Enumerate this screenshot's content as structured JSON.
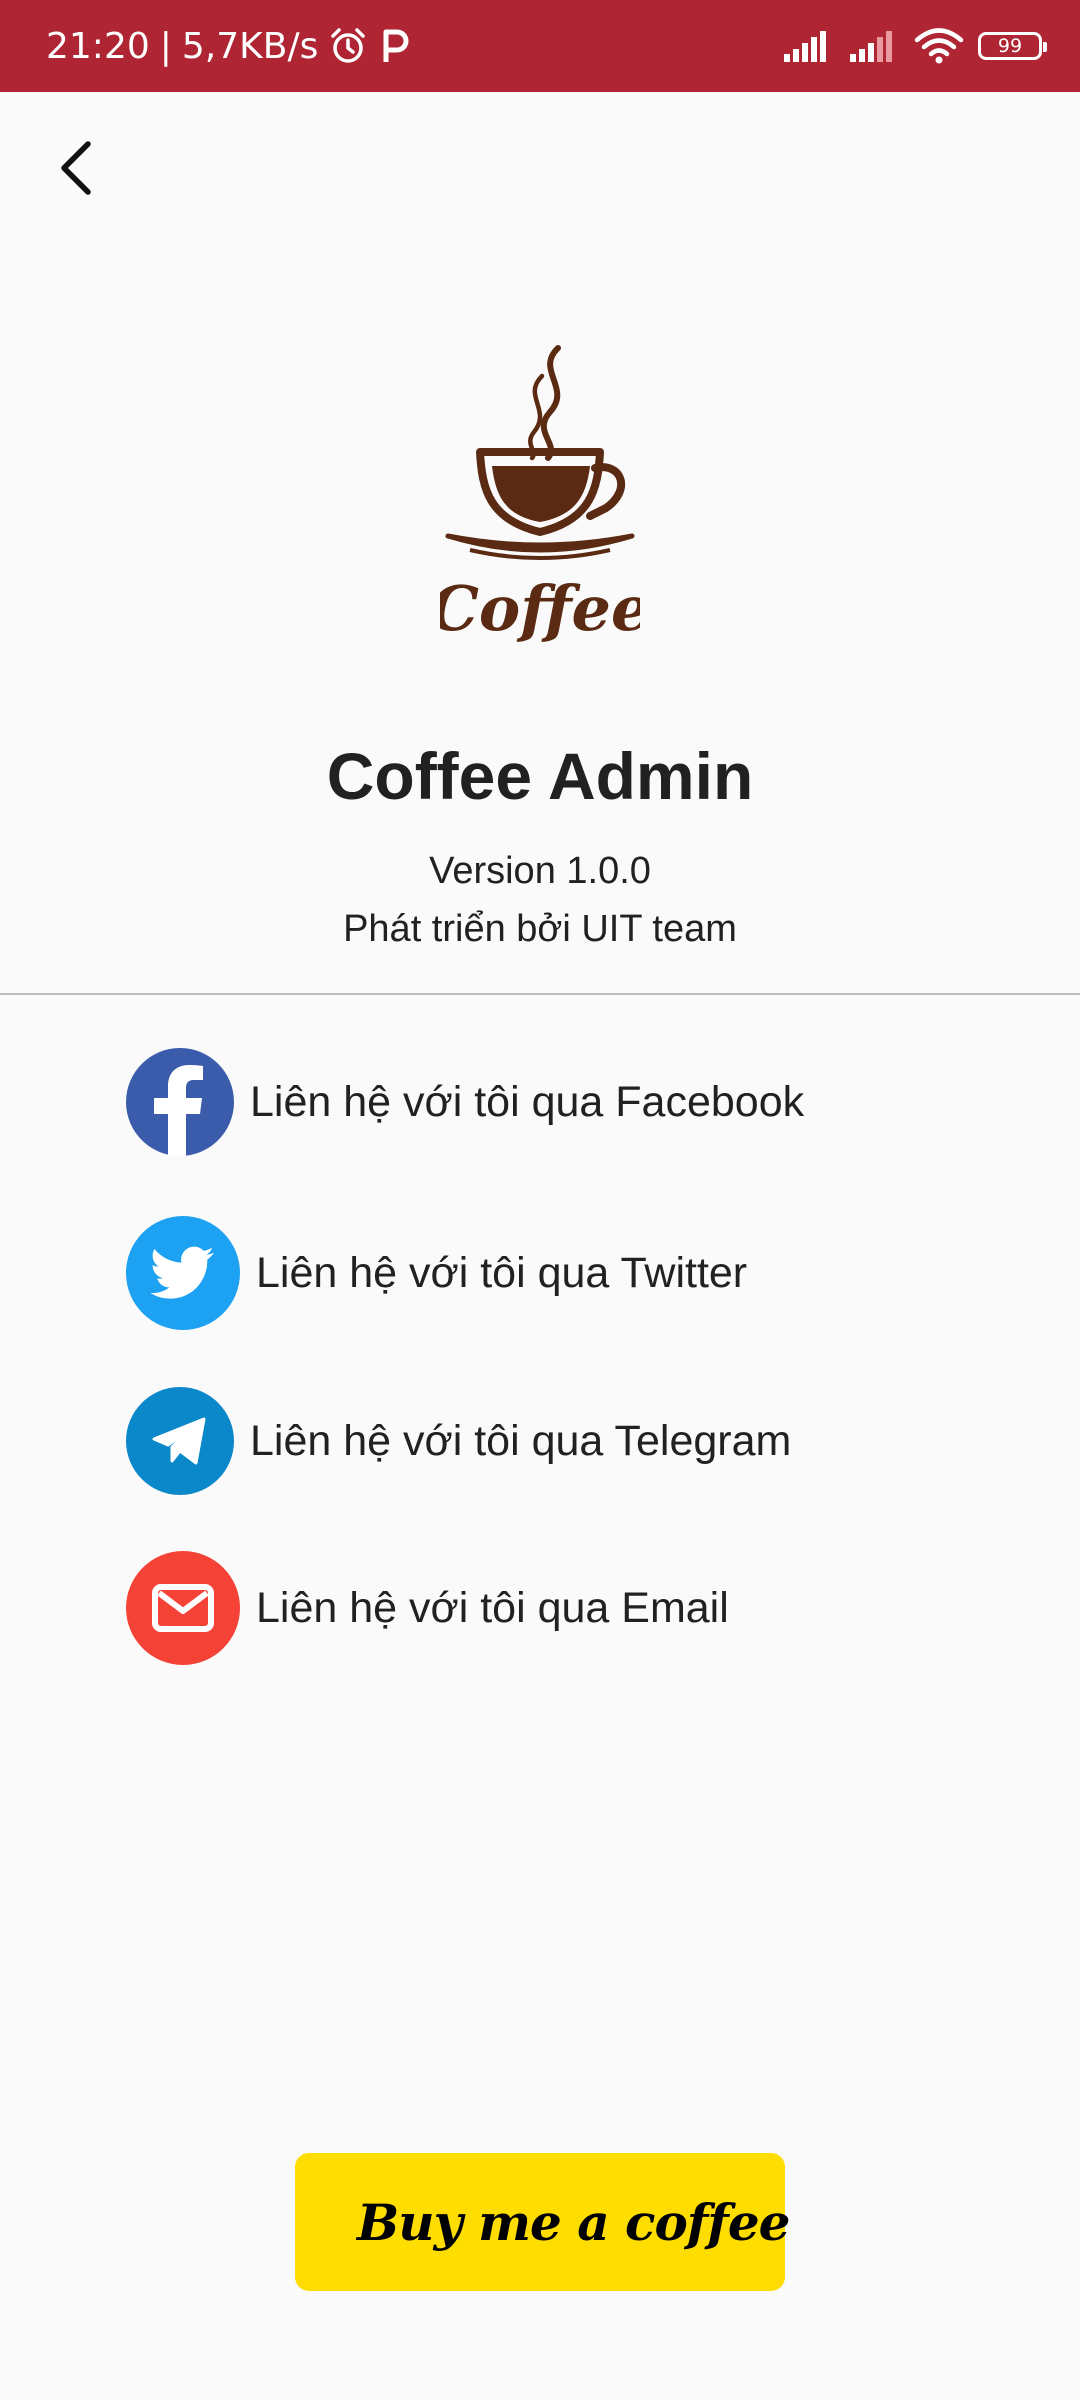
{
  "status_bar": {
    "time": "21:20",
    "separator": "|",
    "network_speed": "5,7KB/s",
    "icons": [
      "alarm-icon",
      "parking-app-icon",
      "signal-icon",
      "signal-icon-2",
      "wifi-icon",
      "battery-icon"
    ],
    "battery_level": "99"
  },
  "header": {
    "back_icon": "chevron-left-icon"
  },
  "logo": {
    "text": "Coffee",
    "color": "#5a2a12"
  },
  "app": {
    "title": "Coffee Admin",
    "version": "Version 1.0.0",
    "developer": "Phát triển bởi UIT team"
  },
  "contacts": [
    {
      "label": "Liên hệ với tôi qua Facebook",
      "icon": "facebook-icon",
      "color": "#3b5bab"
    },
    {
      "label": "Liên hệ với tôi qua Twitter",
      "icon": "twitter-icon",
      "color": "#1da1f2"
    },
    {
      "label": "Liên hệ với tôi qua Telegram",
      "icon": "telegram-icon",
      "color": "#0a88ca"
    },
    {
      "label": "Liên hệ với tôi qua Email",
      "icon": "email-icon",
      "color": "#f44336"
    }
  ],
  "donate": {
    "label": "Buy me a coffee",
    "icon": "coffee-cup-icon",
    "color": "#ffdd00"
  },
  "colors": {
    "status_bar": "#b02533",
    "background": "#fafafa",
    "text": "#212121"
  }
}
